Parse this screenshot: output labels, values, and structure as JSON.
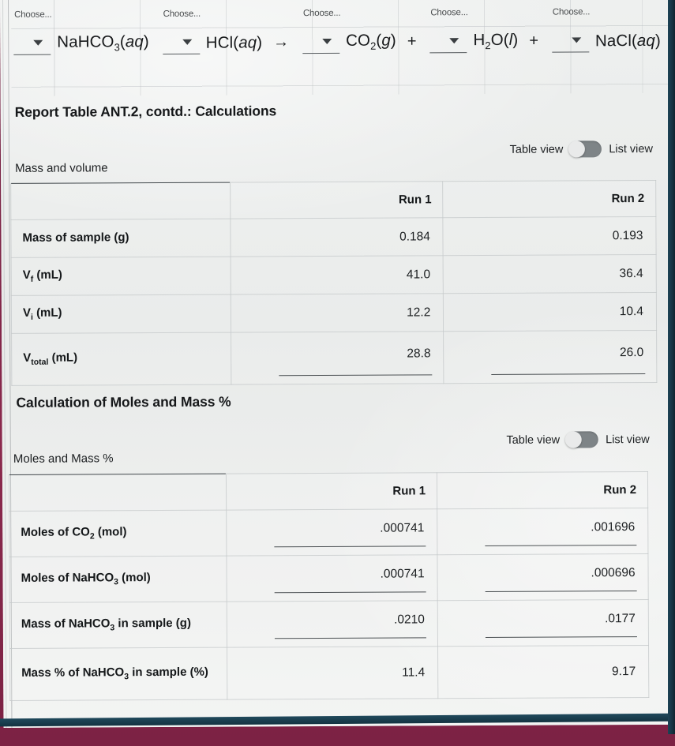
{
  "equation": {
    "dropdown_label": "Choose...",
    "terms": [
      {
        "coefficient": "",
        "formula": "NaHCO<sub>3</sub>(<i>aq</i>)",
        "operator": ""
      },
      {
        "coefficient": "",
        "formula": "HCl(<i>aq</i>)",
        "operator": "→"
      },
      {
        "coefficient": "",
        "formula": "CO<sub>2</sub>(<i>g</i>)",
        "operator": "+"
      },
      {
        "coefficient": "",
        "formula": "H<sub>2</sub>O(<i>l</i>)",
        "operator": "+"
      },
      {
        "coefficient": "",
        "formula": "NaCl(<i>aq</i>)",
        "operator": ""
      }
    ]
  },
  "section1": {
    "title": "Report Table ANT.2, contd.: Calculations",
    "toggle": {
      "left_label": "Table view",
      "right_label": "List view",
      "state": "table"
    },
    "caption": "Mass and volume",
    "columns": [
      "",
      "Run 1",
      "Run 2"
    ],
    "rows": [
      {
        "label": "Mass of sample (g)",
        "run1": "0.184",
        "run2": "0.193",
        "input": false
      },
      {
        "label": "V<sub>f</sub> (mL)",
        "run1": "41.0",
        "run2": "36.4",
        "input": false
      },
      {
        "label": "V<sub>i</sub> (mL)",
        "run1": "12.2",
        "run2": "10.4",
        "input": false
      },
      {
        "label": "V<sub>total</sub> (mL)",
        "run1": "28.8",
        "run2": "26.0",
        "input": true
      }
    ]
  },
  "section2": {
    "title": "Calculation of Moles and Mass %",
    "toggle": {
      "left_label": "Table view",
      "right_label": "List view",
      "state": "table"
    },
    "caption": "Moles and Mass %",
    "columns": [
      "",
      "Run 1",
      "Run 2"
    ],
    "rows": [
      {
        "label": "Moles of CO<sub>2</sub> (mol)",
        "run1": ".000741",
        "run2": ".001696",
        "input": true
      },
      {
        "label": "Moles of NaHCO<sub>3</sub> (mol)",
        "run1": ".000741",
        "run2": ".000696",
        "input": true
      },
      {
        "label": "Mass of NaHCO<sub>3</sub> in sample (g)",
        "run1": ".0210",
        "run2": ".0177",
        "input": true
      },
      {
        "label": "Mass % of NaHCO<sub>3</sub> in sample (%)",
        "run1": "11.4",
        "run2": "9.17",
        "input": false
      }
    ]
  },
  "colors": {
    "page_background": "#eceeed",
    "photo_background": "#7a1f42",
    "bezel": "#1d4356",
    "text": "#16181a",
    "rule": "#40474b",
    "toggle_track": "#7e8487"
  }
}
